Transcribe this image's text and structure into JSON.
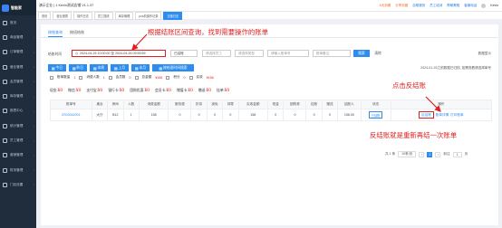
{
  "sidebar": {
    "logo_text": "智能家",
    "items": [
      {
        "label": "首页",
        "icon": "home-icon"
      },
      {
        "label": "商品管理",
        "icon": "goods-icon"
      },
      {
        "label": "订单管理",
        "icon": "order-icon"
      },
      {
        "label": "营业管理",
        "icon": "business-icon"
      },
      {
        "label": "会员管理",
        "icon": "member-icon"
      },
      {
        "label": "库存管理",
        "icon": "stock-icon"
      },
      {
        "label": "报表中心",
        "icon": "report-icon"
      },
      {
        "label": "统计管理",
        "icon": "stats-icon"
      },
      {
        "label": "员工管理",
        "icon": "staff-icon"
      },
      {
        "label": "营销管理",
        "icon": "marketing-icon"
      },
      {
        "label": "财务管理",
        "icon": "finance-icon"
      },
      {
        "label": "门店设置",
        "icon": "store-icon"
      }
    ]
  },
  "topbar": {
    "store_name": "演示企业 | 1 Kevin测试店铺 V1.1.37",
    "links": [
      "6天到期",
      "分享到圈",
      "自助服务",
      "员工培训",
      "帮助教程",
      "客服电话"
    ],
    "user": "Kevin"
  },
  "tabs": [
    "首页",
    "营业报表",
    "操作日志",
    "员工提成",
    "库存管理",
    "pos机操作记录",
    "交接日志"
  ],
  "active_tab_index": 6,
  "subtabs": [
    "按账查询",
    "按班结账"
  ],
  "filters": {
    "time_label": "结账时间",
    "date_range": "2024-04-25 10:00:00 至 2024-04-26 09:59:59",
    "status_placeholder": "已结账",
    "cashier_placeholder": "请选择员工",
    "type_placeholder": "请选择类型",
    "keyword_placeholder": "请输入账单号",
    "remark_placeholder": "账单备注",
    "search_btn": "搜索",
    "reset_btn": "清除"
  },
  "quick_buttons": [
    "今日",
    "昨日",
    "本周",
    "上月",
    "本月",
    "按结班时间搜索"
  ],
  "checkbox_row": {
    "items": [
      "账单数量",
      "消费人数",
      "会员数",
      "总金额",
      "积分",
      "实收"
    ],
    "values": [
      "1",
      "1",
      "0",
      "¥158",
      "0",
      "¥158"
    ]
  },
  "right_note_1": "数据显示",
  "right_note_2": "2024-01-25之前数据已归档, 如需查看请选择单号",
  "summary": [
    {
      "label": "现金:",
      "value": "¥0"
    },
    {
      "label": "微信:",
      "value": "¥0"
    },
    {
      "label": "支付宝:",
      "value": "¥0"
    },
    {
      "label": "银行卡:",
      "value": "¥0"
    },
    {
      "label": "团购优惠:",
      "value": "¥0"
    },
    {
      "label": "会员卡:",
      "value": "¥0"
    },
    {
      "label": "储值卡:",
      "value": "¥0"
    },
    {
      "label": "赠送:",
      "value": "¥0"
    },
    {
      "label": "挂单:",
      "value": "¥0"
    }
  ],
  "table": {
    "headers": [
      "账单号",
      "桌台",
      "房间",
      "人数",
      "消费金额",
      "服务费",
      "折扣",
      "减免",
      "抹零",
      "实收金额",
      "现金",
      "团购券",
      "挂账",
      "赠送",
      "结账人",
      "状态",
      "操作"
    ],
    "rows": [
      [
        "ZS03042001",
        "大厅",
        "B12",
        "1",
        "158",
        "0",
        "0",
        "0",
        "0",
        "158",
        "0",
        "0",
        "0",
        "0",
        "158.00",
        "已结账",
        ""
      ]
    ],
    "ops": [
      "反结账",
      "账单详情",
      "打印账单"
    ]
  },
  "pager": {
    "total": "共 1 条",
    "page_size": "10条/页",
    "current": "1",
    "goto_label": "前往",
    "goto_value": "1",
    "goto_suffix": "页"
  },
  "annotations": {
    "top": "根据结账区间查询，找到需要操作的账单",
    "click": "点击反结账",
    "bottom": "反结账就是重新再结一次账单"
  }
}
